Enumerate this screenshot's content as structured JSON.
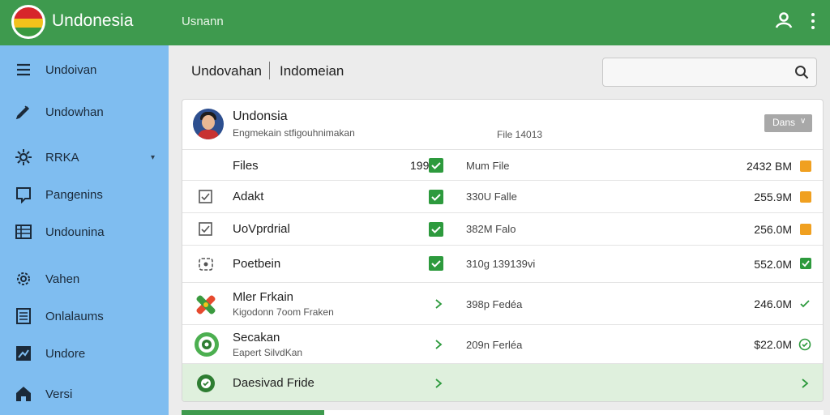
{
  "header": {
    "app_title": "Undonesia",
    "user_label": "Usnann"
  },
  "sidebar": {
    "items": [
      {
        "label": "Undoivan",
        "icon": "menu-icon"
      },
      {
        "label": "Undowhan",
        "icon": "edit-icon"
      },
      {
        "label": "RRKA",
        "icon": "gear-icon",
        "caret": "▾"
      },
      {
        "label": "Pangenins",
        "icon": "comment-icon"
      },
      {
        "label": "Undounina",
        "icon": "table-icon"
      },
      {
        "label": "Vahen",
        "icon": "settings-icon"
      },
      {
        "label": "Onlalaums",
        "icon": "list-icon"
      },
      {
        "label": "Undore",
        "icon": "chart-icon"
      },
      {
        "label": "Versi",
        "icon": "home-icon"
      }
    ]
  },
  "breadcrumb": {
    "first": "Undovahan",
    "second": "Indomeian"
  },
  "search": {
    "value": "",
    "placeholder": ""
  },
  "card": {
    "title": "Undonsia",
    "subtitle": "Engmekain stfigouhnimakan",
    "file_label": "File 14013",
    "dropdown": "Dans"
  },
  "rows": [
    {
      "name": "Files",
      "count": "199",
      "file": "Mum  File",
      "size": "2432 BM",
      "badge": "orange"
    },
    {
      "name": "Adakt",
      "file": "330U  Falle",
      "size": "255.9M",
      "badge": "orange"
    },
    {
      "name": "UoVprdrial",
      "file": "382M  Falo",
      "size": "256.0M",
      "badge": "orange"
    },
    {
      "name": "Poetbein",
      "file": "310g  139139vi",
      "size": "552.0M",
      "badge": "green"
    },
    {
      "name": "Mler Frkain",
      "sub": "Kigodonn 7oom Fraken",
      "file": "398p  Fedéa",
      "size": "246.0M"
    },
    {
      "name": "Secakan",
      "sub": "Eapert SilvdKan",
      "file": "209n  Ferléa",
      "size": "$22.0M"
    },
    {
      "name": "Daesivad Fride"
    }
  ],
  "colors": {
    "topbar": "#3e9a4e",
    "sidebar": "#7fbdf0",
    "check": "#2d9a3d",
    "badge_orange": "#f0a020",
    "highlight_row": "#dff0dd"
  }
}
